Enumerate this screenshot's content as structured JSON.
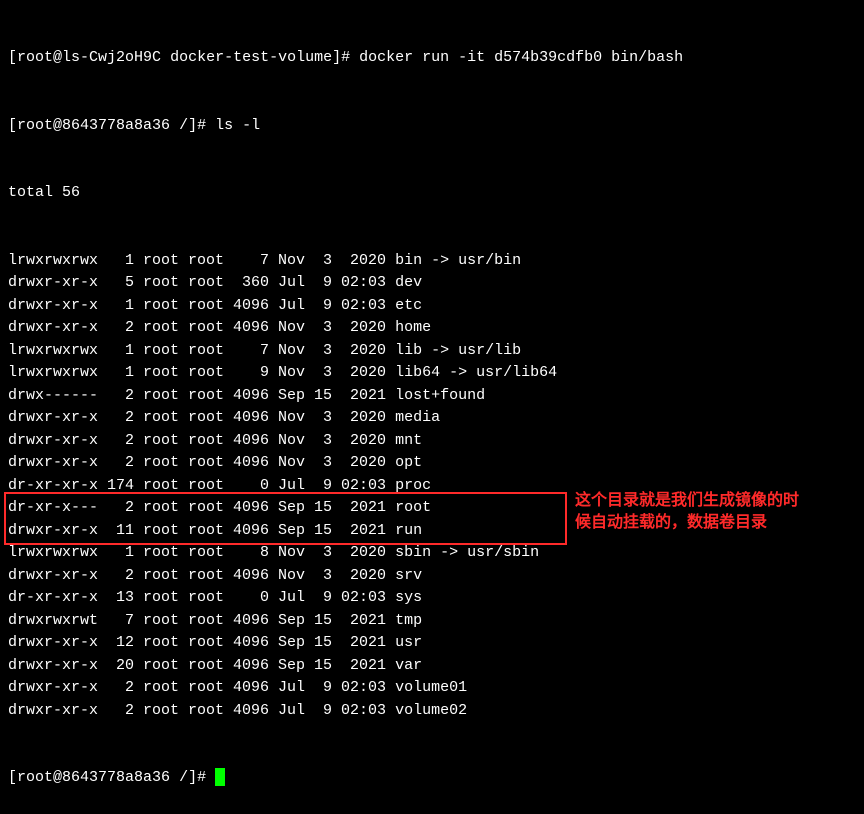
{
  "line1": {
    "prompt_open": "[",
    "user": "root@ls-Cwj2oH9C",
    "sep": " ",
    "cwd": "docker-test-volume",
    "prompt_close": "]# ",
    "cmd": "docker run -it d574b39cdfb0 bin/bash"
  },
  "line2": {
    "prompt_open": "[",
    "user": "root@8643778a8a36",
    "sep": " ",
    "cwd": "/",
    "prompt_close": "]# ",
    "cmd": "ls -l"
  },
  "total": "total 56",
  "rows": [
    {
      "perm": "lrwxrwxrwx",
      "links": "1",
      "owner": "root",
      "group": "root",
      "size": "7",
      "month": "Nov",
      "day": "3",
      "time": "2020",
      "name": "bin -> usr/bin"
    },
    {
      "perm": "drwxr-xr-x",
      "links": "5",
      "owner": "root",
      "group": "root",
      "size": "360",
      "month": "Jul",
      "day": "9",
      "time": "02:03",
      "name": "dev"
    },
    {
      "perm": "drwxr-xr-x",
      "links": "1",
      "owner": "root",
      "group": "root",
      "size": "4096",
      "month": "Jul",
      "day": "9",
      "time": "02:03",
      "name": "etc"
    },
    {
      "perm": "drwxr-xr-x",
      "links": "2",
      "owner": "root",
      "group": "root",
      "size": "4096",
      "month": "Nov",
      "day": "3",
      "time": "2020",
      "name": "home"
    },
    {
      "perm": "lrwxrwxrwx",
      "links": "1",
      "owner": "root",
      "group": "root",
      "size": "7",
      "month": "Nov",
      "day": "3",
      "time": "2020",
      "name": "lib -> usr/lib"
    },
    {
      "perm": "lrwxrwxrwx",
      "links": "1",
      "owner": "root",
      "group": "root",
      "size": "9",
      "month": "Nov",
      "day": "3",
      "time": "2020",
      "name": "lib64 -> usr/lib64"
    },
    {
      "perm": "drwx------",
      "links": "2",
      "owner": "root",
      "group": "root",
      "size": "4096",
      "month": "Sep",
      "day": "15",
      "time": "2021",
      "name": "lost+found"
    },
    {
      "perm": "drwxr-xr-x",
      "links": "2",
      "owner": "root",
      "group": "root",
      "size": "4096",
      "month": "Nov",
      "day": "3",
      "time": "2020",
      "name": "media"
    },
    {
      "perm": "drwxr-xr-x",
      "links": "2",
      "owner": "root",
      "group": "root",
      "size": "4096",
      "month": "Nov",
      "day": "3",
      "time": "2020",
      "name": "mnt"
    },
    {
      "perm": "drwxr-xr-x",
      "links": "2",
      "owner": "root",
      "group": "root",
      "size": "4096",
      "month": "Nov",
      "day": "3",
      "time": "2020",
      "name": "opt"
    },
    {
      "perm": "dr-xr-xr-x",
      "links": "174",
      "owner": "root",
      "group": "root",
      "size": "0",
      "month": "Jul",
      "day": "9",
      "time": "02:03",
      "name": "proc"
    },
    {
      "perm": "dr-xr-x---",
      "links": "2",
      "owner": "root",
      "group": "root",
      "size": "4096",
      "month": "Sep",
      "day": "15",
      "time": "2021",
      "name": "root"
    },
    {
      "perm": "drwxr-xr-x",
      "links": "11",
      "owner": "root",
      "group": "root",
      "size": "4096",
      "month": "Sep",
      "day": "15",
      "time": "2021",
      "name": "run"
    },
    {
      "perm": "lrwxrwxrwx",
      "links": "1",
      "owner": "root",
      "group": "root",
      "size": "8",
      "month": "Nov",
      "day": "3",
      "time": "2020",
      "name": "sbin -> usr/sbin"
    },
    {
      "perm": "drwxr-xr-x",
      "links": "2",
      "owner": "root",
      "group": "root",
      "size": "4096",
      "month": "Nov",
      "day": "3",
      "time": "2020",
      "name": "srv"
    },
    {
      "perm": "dr-xr-xr-x",
      "links": "13",
      "owner": "root",
      "group": "root",
      "size": "0",
      "month": "Jul",
      "day": "9",
      "time": "02:03",
      "name": "sys"
    },
    {
      "perm": "drwxrwxrwt",
      "links": "7",
      "owner": "root",
      "group": "root",
      "size": "4096",
      "month": "Sep",
      "day": "15",
      "time": "2021",
      "name": "tmp"
    },
    {
      "perm": "drwxr-xr-x",
      "links": "12",
      "owner": "root",
      "group": "root",
      "size": "4096",
      "month": "Sep",
      "day": "15",
      "time": "2021",
      "name": "usr"
    },
    {
      "perm": "drwxr-xr-x",
      "links": "20",
      "owner": "root",
      "group": "root",
      "size": "4096",
      "month": "Sep",
      "day": "15",
      "time": "2021",
      "name": "var"
    },
    {
      "perm": "drwxr-xr-x",
      "links": "2",
      "owner": "root",
      "group": "root",
      "size": "4096",
      "month": "Jul",
      "day": "9",
      "time": "02:03",
      "name": "volume01"
    },
    {
      "perm": "drwxr-xr-x",
      "links": "2",
      "owner": "root",
      "group": "root",
      "size": "4096",
      "month": "Jul",
      "day": "9",
      "time": "02:03",
      "name": "volume02"
    }
  ],
  "line_last": {
    "prompt_open": "[",
    "user": "root@8643778a8a36",
    "sep": " ",
    "cwd": "/",
    "prompt_close": "]# "
  },
  "annot": {
    "line1": "这个目录就是我们生成镜像的时",
    "line2": "候自动挂载的，数据卷目录"
  }
}
